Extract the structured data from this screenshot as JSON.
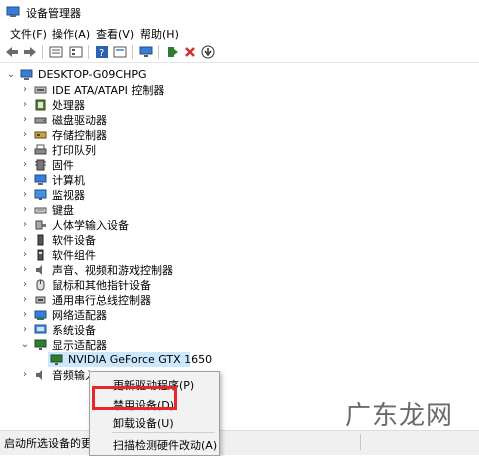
{
  "window": {
    "title": "设备管理器"
  },
  "menu": [
    "文件(F)",
    "操作(A)",
    "查看(V)",
    "帮助(H)"
  ],
  "toolbar": {
    "icons": [
      "back-icon",
      "forward-icon",
      "device-view-icon",
      "properties-icon",
      "help-icon",
      "resources-icon",
      "scan-icon",
      "update-driver-icon",
      "uninstall-icon",
      "disable-icon"
    ],
    "accent_red": "#d32f2f",
    "accent_green": "#2e7d32"
  },
  "tree": {
    "root": "DESKTOP-G09CHPG",
    "items": [
      {
        "label": "IDE ATA/ATAPI 控制器",
        "icon": "ide-controller-icon"
      },
      {
        "label": "处理器",
        "icon": "processor-icon"
      },
      {
        "label": "磁盘驱动器",
        "icon": "disk-drive-icon"
      },
      {
        "label": "存储控制器",
        "icon": "storage-controller-icon"
      },
      {
        "label": "打印队列",
        "icon": "printer-icon"
      },
      {
        "label": "固件",
        "icon": "firmware-icon"
      },
      {
        "label": "计算机",
        "icon": "computer-icon"
      },
      {
        "label": "监视器",
        "icon": "monitor-icon"
      },
      {
        "label": "键盘",
        "icon": "keyboard-icon"
      },
      {
        "label": "人体学输入设备",
        "icon": "hid-icon"
      },
      {
        "label": "软件设备",
        "icon": "software-device-icon"
      },
      {
        "label": "软件组件",
        "icon": "software-component-icon"
      },
      {
        "label": "声音、视频和游戏控制器",
        "icon": "sound-icon"
      },
      {
        "label": "鼠标和其他指针设备",
        "icon": "mouse-icon"
      },
      {
        "label": "通用串行总线控制器",
        "icon": "usb-icon"
      },
      {
        "label": "网络适配器",
        "icon": "network-adapter-icon"
      },
      {
        "label": "系统设备",
        "icon": "system-device-icon"
      },
      {
        "label": "显示适配器",
        "icon": "display-adapter-icon",
        "expanded": true
      },
      {
        "label": "NVIDIA GeForce GTX 1650",
        "icon": "gpu-icon",
        "child": true,
        "selected": true
      },
      {
        "label": "音频输入",
        "icon": "audio-input-icon"
      }
    ]
  },
  "context_menu": {
    "items": [
      "更新驱动程序(P)",
      "禁用设备(D)",
      "卸载设备(U)",
      "扫描检测硬件改动(A)"
    ],
    "highlight_color": "#e8262b"
  },
  "status": {
    "text": "启动所选设备的更新"
  },
  "watermark": "广东龙网"
}
